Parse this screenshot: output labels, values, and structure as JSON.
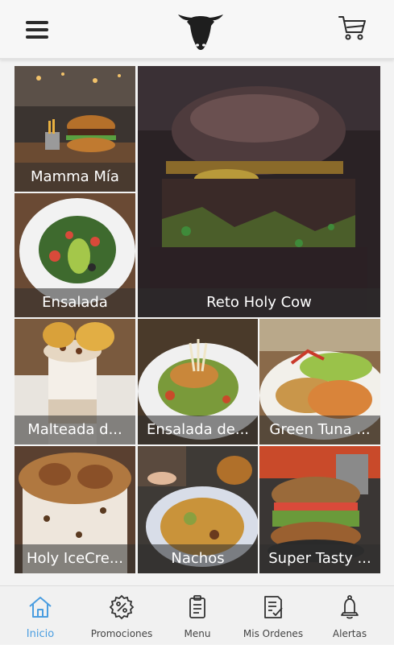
{
  "header": {
    "menu_icon": "hamburger-menu-icon",
    "logo_icon": "bull-head-logo-icon",
    "cart_icon": "shopping-cart-icon"
  },
  "tiles": [
    {
      "label": "Mamma Mía",
      "icon": "burger-photo"
    },
    {
      "label": "Reto Holy Cow",
      "icon": "burger-photo"
    },
    {
      "label": "Ensalada",
      "icon": "salad-photo"
    },
    {
      "label": "Malteada d...",
      "icon": "milkshake-photo"
    },
    {
      "label": "Ensalada de...",
      "icon": "salad-photo"
    },
    {
      "label": "Green Tuna ...",
      "icon": "tuna-photo"
    },
    {
      "label": "Holy IceCre...",
      "icon": "ice-cream-photo"
    },
    {
      "label": "Nachos",
      "icon": "nachos-photo"
    },
    {
      "label": "Super Tasty ...",
      "icon": "burger-photo"
    }
  ],
  "bottom_nav": [
    {
      "label": "Inicio",
      "icon": "home-icon",
      "active": true
    },
    {
      "label": "Promociones",
      "icon": "percent-badge-icon",
      "active": false
    },
    {
      "label": "Menu",
      "icon": "clipboard-menu-icon",
      "active": false
    },
    {
      "label": "Mis Ordenes",
      "icon": "checklist-icon",
      "active": false
    },
    {
      "label": "Alertas",
      "icon": "bell-icon",
      "active": false
    }
  ],
  "colors": {
    "accent": "#4a9de0",
    "caption_bg": "rgba(45,45,45,0.55)"
  }
}
